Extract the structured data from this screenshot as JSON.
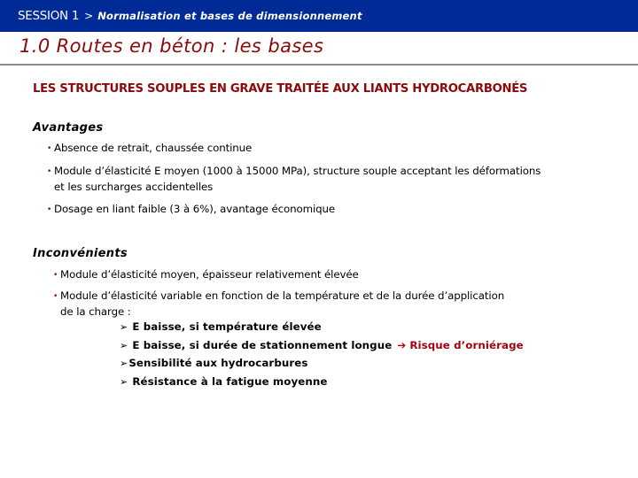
{
  "header": {
    "session": "SESSION 1",
    "separator": ">",
    "subtitle": "Normalisation et bases de dimensionnement"
  },
  "slide": {
    "title": "1.0 Routes en béton : les bases",
    "section_heading": "LES STRUCTURES SOUPLES EN GRAVE TRAITÉE AUX LIANTS HYDROCARBONÉS"
  },
  "advantages": {
    "title": "Avantages",
    "items": [
      {
        "line1": "Absence de retrait, chaussée continue"
      },
      {
        "line1": "Module d’élasticité E moyen (1000 à 15000 MPa),  structure souple acceptant les déformations",
        "line2": "et les surcharges accidentelles"
      },
      {
        "line1": "Dosage en liant faible (3 à 6%), avantage économique"
      }
    ]
  },
  "disadvantages": {
    "title": "Inconvénients",
    "items": [
      {
        "line1": "Module d’élasticité moyen, épaisseur relativement élevée"
      },
      {
        "line1": "Module d’élasticité variable en fonction de la température et de la durée d’application",
        "line2": "de la charge :"
      }
    ],
    "sub_items": [
      {
        "marker": "➢",
        "text": "E baisse, si température élevée"
      },
      {
        "marker": "➢",
        "text": "E baisse, si durée de stationnement longue",
        "arrow": "➔",
        "consequence": "Risque d’orniérage"
      },
      {
        "marker": "➢",
        "text": "Sensibilité aux hydrocarbures"
      },
      {
        "marker": "➢",
        "text": "Résistance à la fatigue moyenne"
      }
    ]
  },
  "bullet_glyph": "•",
  "colors": {
    "header_bg": "#002a96",
    "title_red": "#8b0a0a",
    "risk_red": "#a3000f",
    "rule_gray": "#8c8c8c"
  }
}
